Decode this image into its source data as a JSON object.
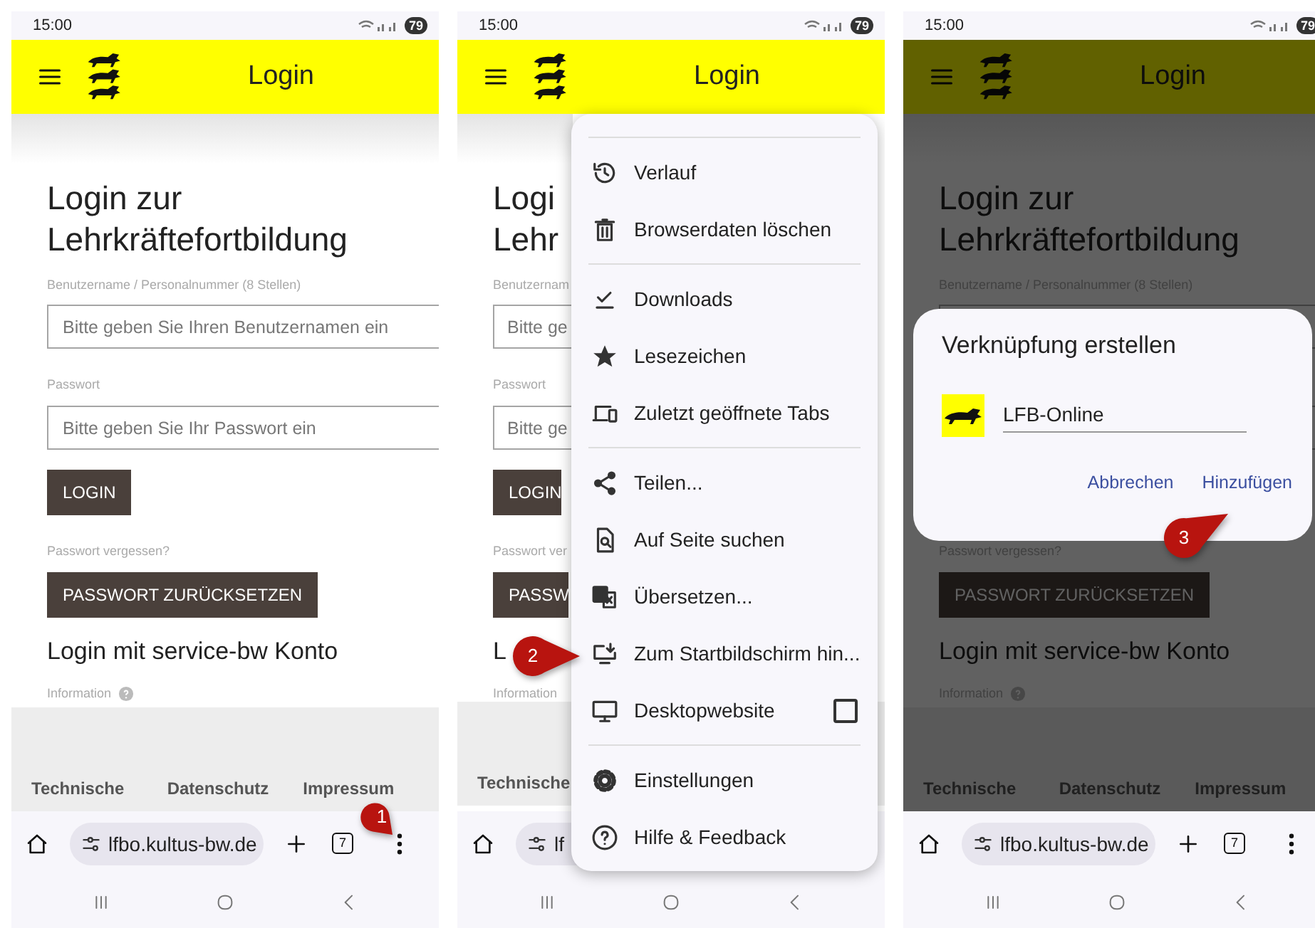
{
  "screens": [
    {
      "status": {
        "time": "15:00",
        "battery": "79"
      },
      "header": {
        "title": "Login"
      },
      "page": {
        "heading": [
          "Login zur",
          "Lehrkräftefortbildung"
        ],
        "username_label": "Benutzername / Personalnummer (8 Stellen)",
        "username_placeholder": "Bitte geben Sie Ihren Benutzernamen ein",
        "password_label": "Passwort",
        "password_placeholder": "Bitte geben Sie Ihr Passwort ein",
        "login_button": "LOGIN",
        "forgot_label": "Passwort vergessen?",
        "reset_button": "PASSWORT ZURÜCKSETZEN",
        "service_heading": "Login mit service-bw Konto",
        "info_label": "Information",
        "info_help": true,
        "footer_links": [
          "Technische",
          "Datenschutz",
          "Impressum"
        ]
      },
      "browser": {
        "url": "lfbo.kultus-bw.de",
        "tabs": "7"
      },
      "callout": {
        "number": "1"
      }
    },
    {
      "status": {
        "time": "15:00",
        "battery": "79"
      },
      "header": {
        "title": "Login"
      },
      "page": {
        "heading": [
          "Logi",
          "Lehr"
        ],
        "username_label": "Benutzernam",
        "username_placeholder": "Bitte ge",
        "password_label": "Passwort",
        "password_placeholder": "Bitte ge",
        "login_button": "LOGIN",
        "forgot_label": "Passwort ver",
        "reset_button": "PASSW",
        "service_heading": "L",
        "info_label": "Information",
        "info_help": false,
        "footer_links": [
          "Technische"
        ]
      },
      "browser": {
        "url": "lf"
      },
      "menu": {
        "items": [
          {
            "kind": "divider"
          },
          {
            "kind": "item",
            "label": "Verlauf"
          },
          {
            "kind": "item",
            "label": "Browserdaten löschen"
          },
          {
            "kind": "divider"
          },
          {
            "kind": "item",
            "label": "Downloads"
          },
          {
            "kind": "item",
            "label": "Lesezeichen"
          },
          {
            "kind": "item",
            "label": "Zuletzt geöffnete Tabs"
          },
          {
            "kind": "divider"
          },
          {
            "kind": "item",
            "label": "Teilen..."
          },
          {
            "kind": "item",
            "label": "Auf Seite suchen"
          },
          {
            "kind": "item",
            "label": "Übersetzen..."
          },
          {
            "kind": "item",
            "label": "Zum Startbildschirm hin..."
          },
          {
            "kind": "checkbox",
            "label": "Desktopwebsite",
            "checked": false
          },
          {
            "kind": "divider"
          },
          {
            "kind": "item",
            "label": "Einstellungen"
          },
          {
            "kind": "item",
            "label": "Hilfe & Feedback"
          }
        ]
      },
      "callout": {
        "number": "2"
      }
    },
    {
      "status": {
        "time": "15:00",
        "battery": "79"
      },
      "header": {
        "title": "Login"
      },
      "page": {
        "heading": [
          "Login zur",
          "Lehrkräftefortbildung"
        ],
        "username_label": "Benutzername / Personalnummer (8 Stellen)",
        "forgot_label": "Passwort vergessen?",
        "reset_button": "PASSWORT ZURÜCKSETZEN",
        "service_heading": "Login mit service-bw Konto",
        "info_label": "Information",
        "info_help": true,
        "footer_links": [
          "Technische",
          "Datenschutz",
          "Impressum"
        ]
      },
      "browser": {
        "url": "lfbo.kultus-bw.de",
        "tabs": "7"
      },
      "dimmed": true,
      "dialog": {
        "title": "Verknüpfung erstellen",
        "name_value": "LFB-Online",
        "buttons": [
          "Abbrechen",
          "Hinzufügen"
        ]
      },
      "callout": {
        "number": "3"
      }
    }
  ]
}
